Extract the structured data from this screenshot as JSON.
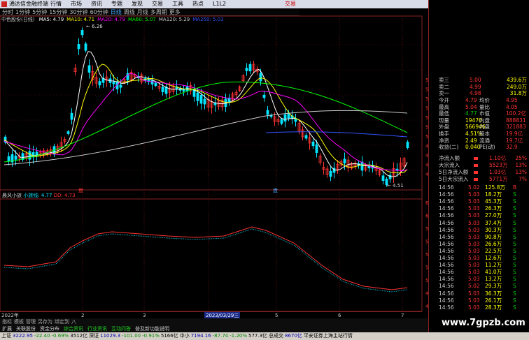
{
  "title_bar": {
    "app_name": "通达信金融终端",
    "menus": [
      "行情",
      "市场",
      "资讯",
      "专题",
      "发现",
      "交易",
      "工具",
      "热点",
      "L1L2"
    ],
    "trade_button": "交易"
  },
  "period_bar": {
    "items": [
      "分时",
      "1分钟",
      "5分钟",
      "15分钟",
      "30分钟",
      "60分钟",
      "日线",
      "周线",
      "月线",
      "多周期",
      "更多"
    ],
    "active": "日线"
  },
  "ma_legend": {
    "stock": "中色股份(日线)",
    "items": [
      {
        "label": "MA5: 4.79",
        "color": "#ffffff"
      },
      {
        "label": "MA10: 4.71",
        "color": "#ffff00"
      },
      {
        "label": "MA20: 4.79",
        "color": "#ff00ff"
      },
      {
        "label": "MA60: 5.07",
        "color": "#00ff00"
      },
      {
        "label": "MA120: 5.29",
        "color": "#cccccc"
      },
      {
        "label": "MA250: 5.03",
        "color": "#3355ff"
      }
    ]
  },
  "chart_labels": {
    "high_label": "6.26",
    "low_label": "4.51",
    "marker_left": "盘",
    "marker_right": "盘"
  },
  "price_axis": [
    "5.80",
    "5.60",
    "5.40",
    "5.30",
    "5.20",
    "5.10",
    "5.00",
    "4.90",
    "4.80",
    "4.70",
    "4.60"
  ],
  "sub_axis": [
    "6.20",
    "6.00",
    "5.80",
    "5.60",
    "5.40",
    "5.20",
    "5.00",
    "4.80",
    "4.60"
  ],
  "sub_legend": {
    "name": "晨风小旅",
    "line1": "小旅线: 4.77",
    "line2": "DD: 4.73"
  },
  "date_bar": {
    "labels": [
      "2022年",
      "2",
      "3",
      "4",
      "5",
      "6",
      "7"
    ],
    "cursor": "2023/03/29三"
  },
  "toolbar": [
    "指标",
    "模板",
    "管理",
    "另存为",
    "绑定到",
    "八"
  ],
  "tabs": [
    {
      "label": "扩展",
      "style": "n"
    },
    {
      "label": "关联股份",
      "style": "n"
    },
    {
      "label": "资金分布",
      "style": "n"
    },
    {
      "label": "综合资讯",
      "style": "g"
    },
    {
      "label": "行业资讯",
      "style": "g"
    },
    {
      "label": "互动问答",
      "style": "g"
    },
    {
      "label": "普及新功能说明",
      "style": "n"
    }
  ],
  "status_bar": [
    {
      "name": "上证",
      "value": "3222.95",
      "change": "-22.40",
      "pct": "-0.69%",
      "amount": "3512亿"
    },
    {
      "name": "深证",
      "value": "11029.3",
      "change": "-101.00",
      "pct": "-0.91%",
      "amount": "5166亿"
    },
    {
      "name": "中小",
      "value": "7194.16",
      "change": "-87.74",
      "pct": "-1.20%",
      "amount": "577.3亿"
    },
    {
      "name": "总成交",
      "value": "8670亿",
      "change": "",
      "pct": "",
      "amount": ""
    }
  ],
  "status_tail": "平安证券上海主站行情",
  "watermark": "www.7gpzb.com",
  "panel": {
    "orders": [
      {
        "label": "卖三",
        "price": "5.00",
        "vol": "439.6万"
      },
      {
        "label": "卖二",
        "price": "4.99",
        "vol": "249.0万"
      },
      {
        "label": "卖一",
        "price": "4.98",
        "vol": "31.8万"
      }
    ],
    "stats": [
      [
        "今开",
        "4.79",
        "均价",
        "4.95"
      ],
      [
        "最高",
        "5.04",
        "量比",
        "4.05"
      ],
      [
        "最低",
        "4.77",
        "市值",
        "100.2亿"
      ],
      [
        "现量",
        "19470",
        "内盘",
        "888831"
      ],
      [
        "外盘",
        "566946",
        "内盘",
        "321883"
      ],
      [
        "换手",
        "4.51%",
        "股本",
        "19.9亿"
      ],
      [
        "净资",
        "2.49",
        "流通",
        "19.7亿"
      ],
      [
        "收益(二)",
        "0.040",
        "PE(动)",
        "32.9"
      ]
    ],
    "flows": [
      {
        "label": "净流入额",
        "value": "1.10亿",
        "pct": "25%"
      },
      {
        "label": "大宗流入",
        "value": "5523万",
        "pct": "13%"
      },
      {
        "label": "5日净流入额",
        "value": "1.03亿",
        "pct": "13%"
      },
      {
        "label": "5日大宗流入",
        "value": "5771万",
        "pct": "7%"
      }
    ],
    "ticks": [
      {
        "time": "14:56",
        "price": "5.02",
        "vol": "125.8万",
        "dir": "B"
      },
      {
        "time": "14:56",
        "price": "5.03",
        "vol": "18.2万",
        "dir": "S"
      },
      {
        "time": "14:56",
        "price": "5.03",
        "vol": "45.3万",
        "dir": "S"
      },
      {
        "time": "14:56",
        "price": "5.03",
        "vol": "26.3万",
        "dir": "S"
      },
      {
        "time": "14:56",
        "price": "5.03",
        "vol": "27.0万",
        "dir": "S"
      },
      {
        "time": "14:56",
        "price": "5.03",
        "vol": "37.4万",
        "dir": "S"
      },
      {
        "time": "14:56",
        "price": "5.03",
        "vol": "30.3万",
        "dir": "S"
      },
      {
        "time": "14:56",
        "price": "5.03",
        "vol": "90.8万",
        "dir": "S"
      },
      {
        "time": "14:56",
        "price": "5.03",
        "vol": "26.6万",
        "dir": "S"
      },
      {
        "time": "14:56",
        "price": "5.03",
        "vol": "22.5万",
        "dir": "S"
      },
      {
        "time": "14:56",
        "price": "5.03",
        "vol": "12.6万",
        "dir": "S"
      },
      {
        "time": "14:56",
        "price": "5.03",
        "vol": "11.2万",
        "dir": "S"
      },
      {
        "time": "14:56",
        "price": "5.03",
        "vol": "41.0万",
        "dir": "S"
      },
      {
        "time": "14:56",
        "price": "5.03",
        "vol": "13.2万",
        "dir": "S"
      },
      {
        "time": "14:56",
        "price": "5.02",
        "vol": "29.3万",
        "dir": "S"
      },
      {
        "time": "14:56",
        "price": "5.03",
        "vol": "36.3万",
        "dir": "S"
      },
      {
        "time": "14:56",
        "price": "5.03",
        "vol": "26.1万",
        "dir": "S"
      },
      {
        "time": "14:56",
        "price": "5.03",
        "vol": "28.3万",
        "dir": "S"
      }
    ]
  },
  "colors": {
    "up": "#ff3333",
    "down": "#00e5ff",
    "ma5": "#ffffff",
    "ma10": "#ffff00",
    "ma20": "#ff00ff",
    "ma60": "#00ff00",
    "ma120": "#cccccc",
    "ma250": "#3355ff"
  }
}
